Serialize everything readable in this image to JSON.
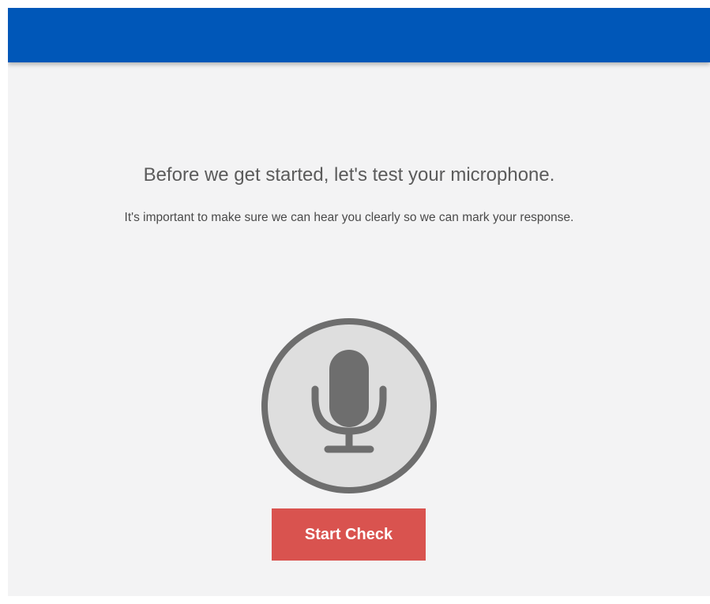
{
  "header": {
    "bar_color": "#0057b8"
  },
  "main": {
    "headline": "Before we get started, let's test your microphone.",
    "subline": "It's important to make sure we can hear you clearly so we can mark your response.",
    "mic_icon": "microphone-icon",
    "start_button_label": "Start Check",
    "button_color": "#d9534f"
  }
}
